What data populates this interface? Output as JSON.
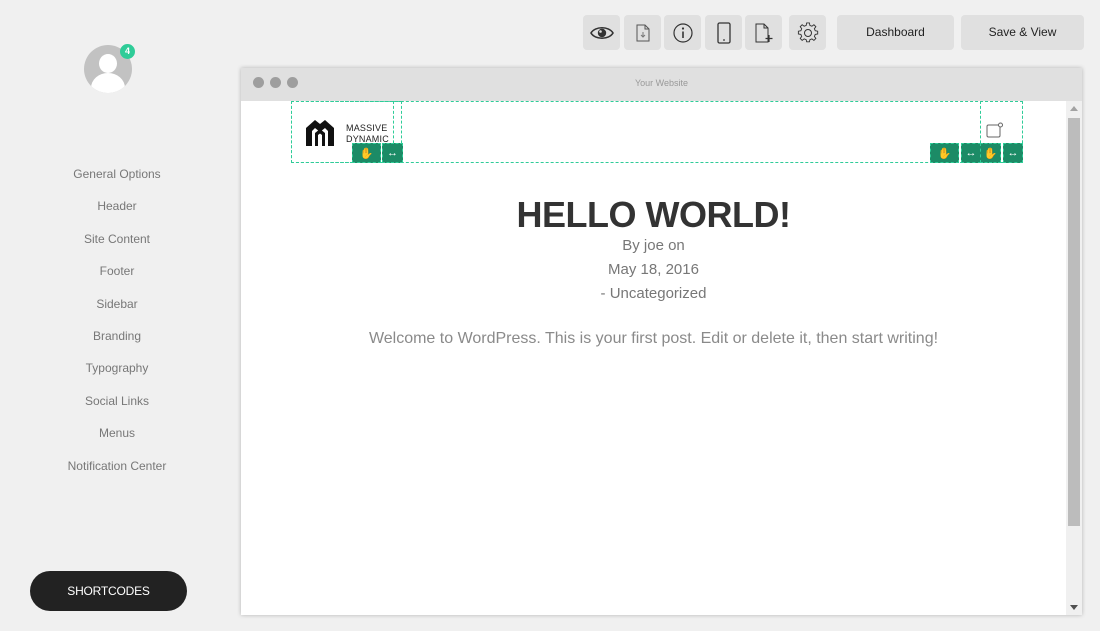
{
  "sidebar": {
    "avatar": {
      "icon": "user-avatar-icon",
      "badge_count": "4"
    },
    "items": [
      {
        "label": "General Options"
      },
      {
        "label": "Header"
      },
      {
        "label": "Site Content"
      },
      {
        "label": "Footer"
      },
      {
        "label": "Sidebar"
      },
      {
        "label": "Branding"
      },
      {
        "label": "Typography"
      },
      {
        "label": "Social Links"
      },
      {
        "label": "Menus"
      },
      {
        "label": "Notification Center"
      }
    ],
    "shortcodes_label": "SHORTCODES"
  },
  "toolbar": {
    "icons": [
      "eye-icon",
      "file-download-icon",
      "info-icon",
      "tablet-icon",
      "file-add-icon",
      "gear-icon"
    ],
    "dashboard_label": "Dashboard",
    "save_view_label": "Save & View"
  },
  "browser": {
    "title": "Your Website"
  },
  "site": {
    "logo_line1": "MASSIVE",
    "logo_line2": "DYNAMIC",
    "post_title": "HELLO WORLD!",
    "byline": "By joe on",
    "date": "May 18, 2016",
    "category": "- Uncategorized",
    "body": "Welcome to WordPress. This is your first post. Edit or delete it, then start writing!"
  },
  "colors": {
    "accent": "#2fcc98",
    "handle": "#1c8b66",
    "button_bg": "#e0e0e0",
    "dark_button": "#222222"
  }
}
